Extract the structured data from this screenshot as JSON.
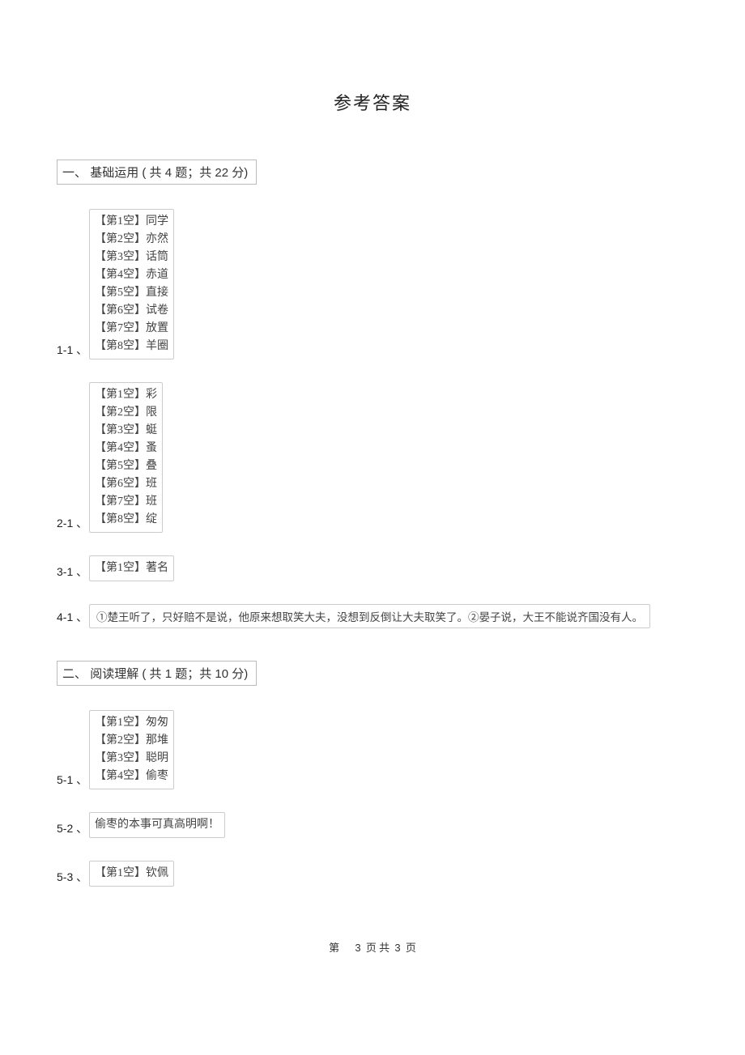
{
  "title": "参考答案",
  "sections": [
    {
      "label_parts": [
        "一、",
        "基础运用",
        "( 共 ",
        "4",
        " 题；共 ",
        "22",
        " 分)"
      ]
    },
    {
      "label_parts": [
        "二、",
        "阅读理解",
        "( 共 ",
        "1",
        " 题；共 ",
        "10",
        " 分)"
      ]
    }
  ],
  "q1": {
    "label": "1-1 、",
    "slots": [
      "【第1空】同学",
      "【第2空】亦然",
      "【第3空】话筒",
      "【第4空】赤道",
      "【第5空】直接",
      "【第6空】试卷",
      "【第7空】放置",
      "【第8空】羊圈"
    ]
  },
  "q2": {
    "label": "2-1 、",
    "slots": [
      "【第1空】彩",
      "【第2空】限",
      "【第3空】蜓",
      "【第4空】蚤",
      "【第5空】叠",
      "【第6空】班",
      "【第7空】班",
      "【第8空】绽"
    ]
  },
  "q3": {
    "label": "3-1 、",
    "slots": [
      "【第1空】著名"
    ]
  },
  "q4": {
    "label": "4-1 、",
    "text": "①楚王听了，只好赔不是说，他原来想取笑大夫，没想到反倒让大夫取笑了。②晏子说，大王不能说齐国没有人。"
  },
  "q5_1": {
    "label": "5-1 、",
    "slots": [
      "【第1空】匆匆",
      "【第2空】那堆",
      "【第3空】聪明",
      "【第4空】偷枣"
    ]
  },
  "q5_2": {
    "label": "5-2 、",
    "text": "偷枣的本事可真高明啊！"
  },
  "q5_3": {
    "label": "5-3 、",
    "slots": [
      "【第1空】钦佩"
    ]
  },
  "footer": {
    "prefix": "第",
    "current": "3",
    "middle": "页 共",
    "total": "3",
    "suffix": "页"
  }
}
